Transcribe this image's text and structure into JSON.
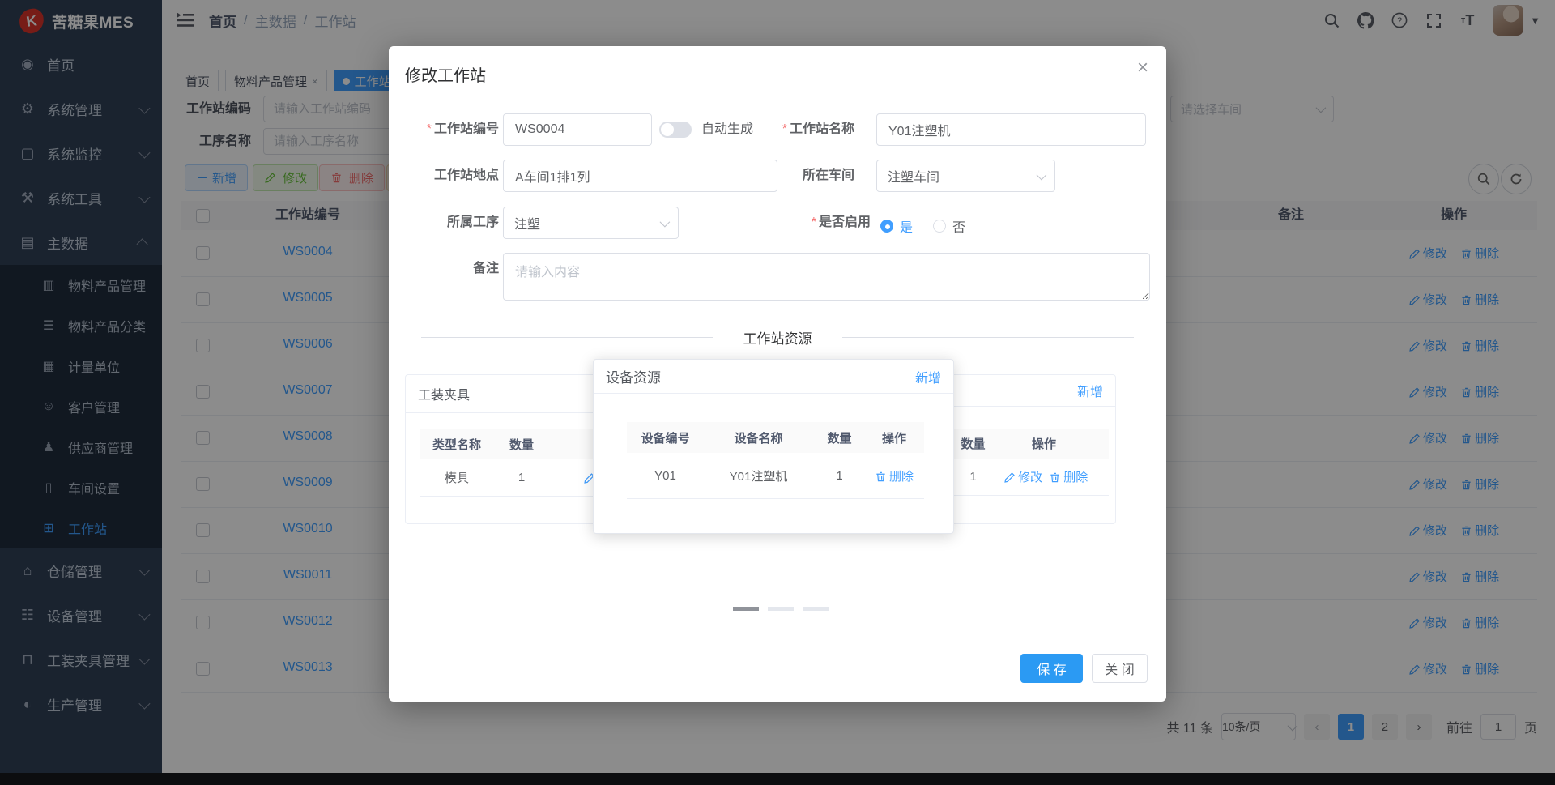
{
  "app": {
    "title": "苦糖果MES",
    "logo_letter": "K"
  },
  "navbar": {
    "breadcrumb": [
      "首页",
      "主数据",
      "工作站"
    ],
    "icons": [
      "search-icon",
      "github-icon",
      "help-icon",
      "fullscreen-icon",
      "font-size-icon",
      "avatar",
      "caret-down-icon"
    ]
  },
  "sidebar": {
    "items": [
      {
        "name": "home",
        "label": "首页",
        "glyph": "◉"
      },
      {
        "name": "system-manage",
        "label": "系统管理",
        "glyph": "⚙",
        "arrow": "down"
      },
      {
        "name": "system-monitor",
        "label": "系统监控",
        "glyph": "▢",
        "arrow": "down"
      },
      {
        "name": "system-tools",
        "label": "系统工具",
        "glyph": "⚒",
        "arrow": "down"
      },
      {
        "name": "master-data",
        "label": "主数据",
        "glyph": "▤",
        "arrow": "up",
        "open": true,
        "children": [
          {
            "name": "material-product-manage",
            "label": "物料产品管理",
            "glyph": "▥"
          },
          {
            "name": "material-product-category",
            "label": "物料产品分类",
            "glyph": "☰"
          },
          {
            "name": "measure-unit",
            "label": "计量单位",
            "glyph": "▦"
          },
          {
            "name": "customer-manage",
            "label": "客户管理",
            "glyph": "☺"
          },
          {
            "name": "supplier-manage",
            "label": "供应商管理",
            "glyph": "♟"
          },
          {
            "name": "workshop-setting",
            "label": "车间设置",
            "glyph": "▯"
          },
          {
            "name": "workstation",
            "label": "工作站",
            "glyph": "⊞",
            "active": true
          }
        ]
      },
      {
        "name": "warehouse-manage",
        "label": "仓储管理",
        "glyph": "⌂",
        "arrow": "down"
      },
      {
        "name": "equipment-manage",
        "label": "设备管理",
        "glyph": "☷",
        "arrow": "down"
      },
      {
        "name": "fixture-manage",
        "label": "工装夹具管理",
        "glyph": "⊓",
        "arrow": "down"
      },
      {
        "name": "production-manage",
        "label": "生产管理",
        "glyph": "◐",
        "arrow": "down"
      }
    ]
  },
  "tabs": [
    {
      "label": "首页",
      "closable": false,
      "active": false
    },
    {
      "label": "物料产品管理",
      "closable": true,
      "active": false
    },
    {
      "label": "工作站",
      "closable": true,
      "active": true
    }
  ],
  "filters": {
    "code_label": "工作站编码",
    "code_placeholder": "请输入工作站编码",
    "process_label": "工序名称",
    "process_placeholder": "请输入工序名称",
    "workshop_placeholder": "请选择车间"
  },
  "toolbar": {
    "add": "新增",
    "edit": "修改",
    "delete": "删除"
  },
  "table": {
    "headers": {
      "code": "工作站编号",
      "remark": "备注",
      "actions": "操作"
    },
    "row_edit": "修改",
    "row_delete": "删除",
    "rows": [
      {
        "code": "WS0004"
      },
      {
        "code": "WS0005"
      },
      {
        "code": "WS0006"
      },
      {
        "code": "WS0007"
      },
      {
        "code": "WS0008"
      },
      {
        "code": "WS0009"
      },
      {
        "code": "WS0010"
      },
      {
        "code": "WS0011"
      },
      {
        "code": "WS0012"
      },
      {
        "code": "WS0013"
      }
    ]
  },
  "pagination": {
    "total": "共 11 条",
    "page_size": "10条/页",
    "pages": [
      "1",
      "2"
    ],
    "active_page": "1",
    "jump_label": "前往",
    "jump_value": "1",
    "jump_unit": "页"
  },
  "modal": {
    "title": "修改工作站",
    "form": {
      "code_label": "工作站编号",
      "code_value": "WS0004",
      "auto_label": "自动生成",
      "name_label": "工作站名称",
      "name_value": "Y01注塑机",
      "location_label": "工作站地点",
      "location_value": "A车间1排1列",
      "workshop_label": "所在车间",
      "workshop_value": "注塑车间",
      "process_label": "所属工序",
      "process_value": "注塑",
      "enabled_label": "是否启用",
      "enabled_yes": "是",
      "enabled_no": "否",
      "remark_label": "备注",
      "remark_placeholder": "请输入内容"
    },
    "divider": "工作站资源",
    "fixture_card": {
      "title": "工装夹具",
      "col_type": "类型名称",
      "col_qty": "数量",
      "row_type": "模具",
      "row_qty": "1",
      "edit": "修改"
    },
    "device_card": {
      "title": "设备资源",
      "add": "新增",
      "col_code": "设备编号",
      "col_name": "设备名称",
      "col_qty": "数量",
      "col_actions": "操作",
      "row_code": "Y01",
      "row_name": "Y01注塑机",
      "row_qty": "1",
      "delete": "删除"
    },
    "right_card": {
      "add": "新增",
      "col_qty": "数量",
      "col_actions": "操作",
      "row_qty": "1",
      "edit": "修改",
      "delete": "删除"
    },
    "save": "保 存",
    "close": "关 闭"
  },
  "colors": {
    "accent": "#409eff",
    "success": "#67c23a",
    "danger": "#f56c6c",
    "warning": "#e6a23c",
    "sidebar_bg": "#304156",
    "submenu_bg": "#1f2d3d"
  }
}
